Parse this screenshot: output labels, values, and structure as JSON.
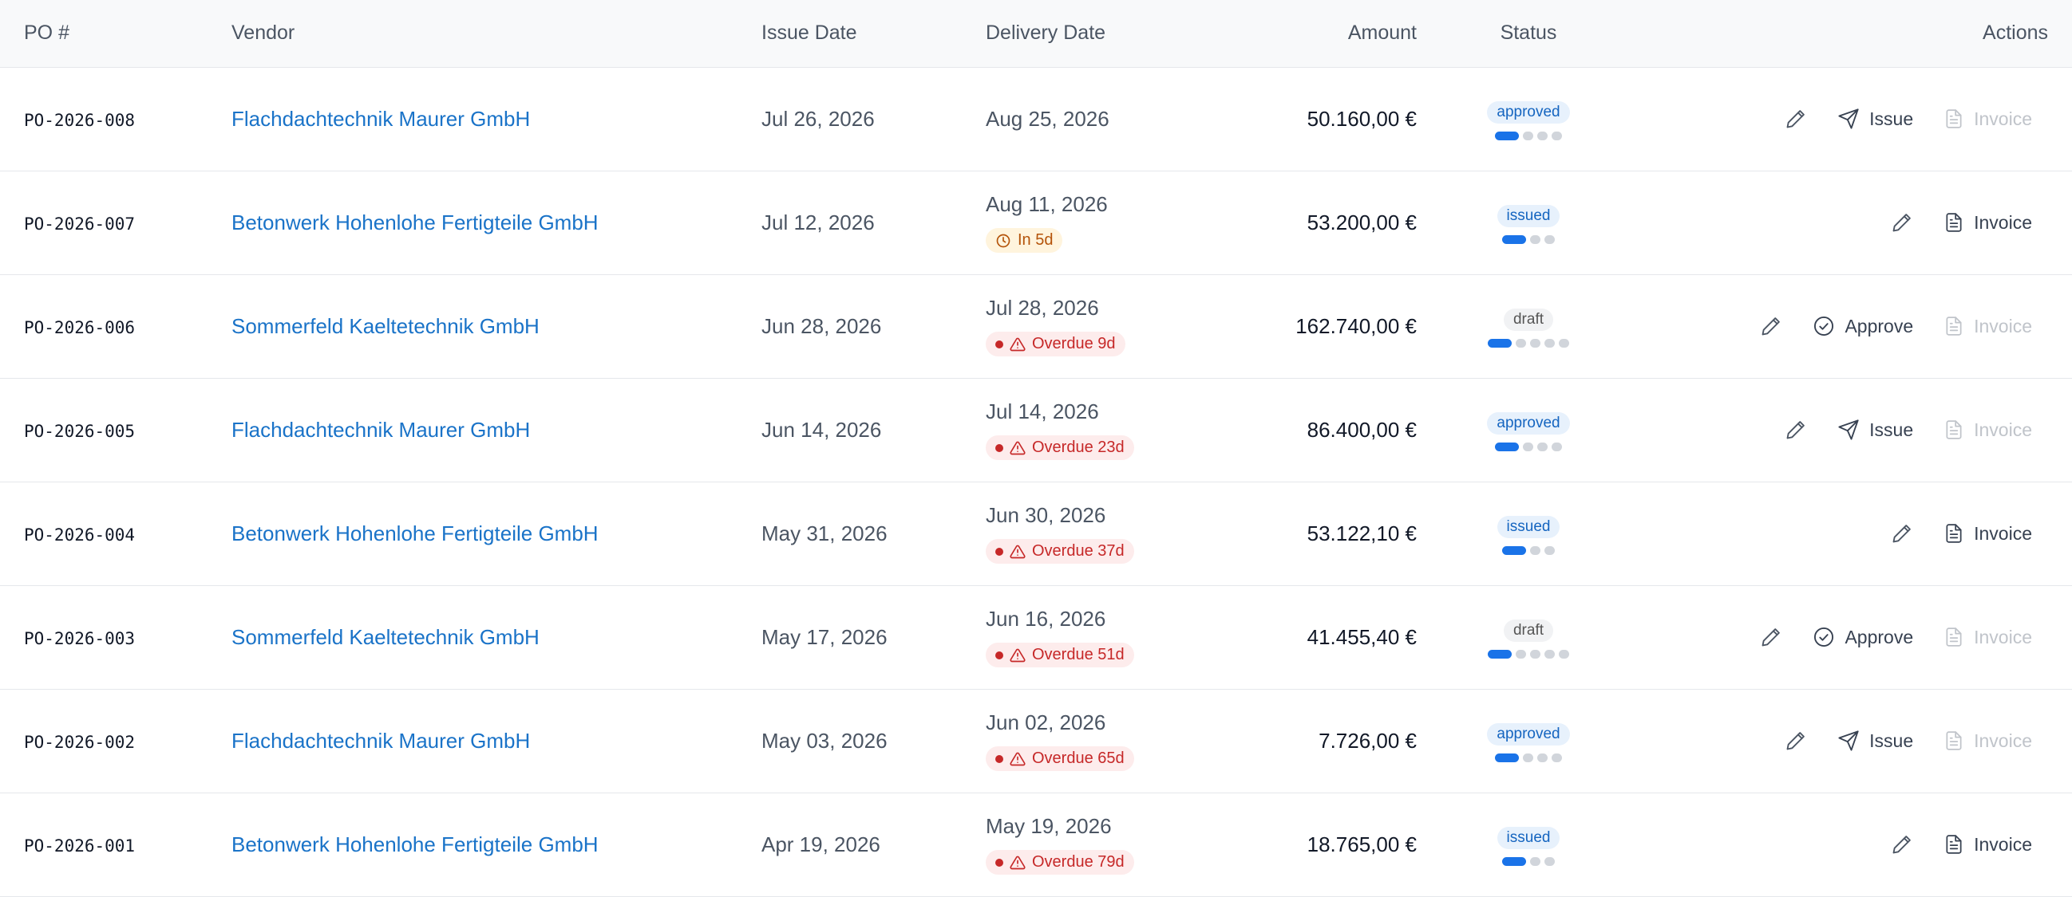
{
  "headers": {
    "po": "PO #",
    "vendor": "Vendor",
    "issue_date": "Issue Date",
    "delivery_date": "Delivery Date",
    "amount": "Amount",
    "status": "Status",
    "actions": "Actions"
  },
  "labels": {
    "issue": "Issue",
    "approve": "Approve",
    "invoice": "Invoice"
  },
  "colors": {
    "link": "#1a73c8",
    "progress_on": "#1a73e8",
    "overdue": "#c62828",
    "soon": "#b45309"
  },
  "rows": [
    {
      "po": "PO-2026-008",
      "vendor": "Flachdachtechnik Maurer GmbH",
      "issue_date": "Jul 26, 2026",
      "delivery_date": "Aug 25, 2026",
      "badge": null,
      "amount": "50.160,00 €",
      "status": "approved",
      "progress_done": 1,
      "progress_total": 4,
      "action": "Issue",
      "invoice_enabled": false
    },
    {
      "po": "PO-2026-007",
      "vendor": "Betonwerk Hohenlohe Fertigteile GmbH",
      "issue_date": "Jul 12, 2026",
      "delivery_date": "Aug 11, 2026",
      "badge": {
        "type": "soon",
        "text": "In 5d"
      },
      "amount": "53.200,00 €",
      "status": "issued",
      "progress_done": 1,
      "progress_total": 3,
      "action": null,
      "invoice_enabled": true
    },
    {
      "po": "PO-2026-006",
      "vendor": "Sommerfeld Kaeltetechnik GmbH",
      "issue_date": "Jun 28, 2026",
      "delivery_date": "Jul 28, 2026",
      "badge": {
        "type": "over",
        "text": "Overdue 9d"
      },
      "amount": "162.740,00 €",
      "status": "draft",
      "progress_done": 1,
      "progress_total": 5,
      "action": "Approve",
      "invoice_enabled": false
    },
    {
      "po": "PO-2026-005",
      "vendor": "Flachdachtechnik Maurer GmbH",
      "issue_date": "Jun 14, 2026",
      "delivery_date": "Jul 14, 2026",
      "badge": {
        "type": "over",
        "text": "Overdue 23d"
      },
      "amount": "86.400,00 €",
      "status": "approved",
      "progress_done": 1,
      "progress_total": 4,
      "action": "Issue",
      "invoice_enabled": false
    },
    {
      "po": "PO-2026-004",
      "vendor": "Betonwerk Hohenlohe Fertigteile GmbH",
      "issue_date": "May 31, 2026",
      "delivery_date": "Jun 30, 2026",
      "badge": {
        "type": "over",
        "text": "Overdue 37d"
      },
      "amount": "53.122,10 €",
      "status": "issued",
      "progress_done": 1,
      "progress_total": 3,
      "action": null,
      "invoice_enabled": true
    },
    {
      "po": "PO-2026-003",
      "vendor": "Sommerfeld Kaeltetechnik GmbH",
      "issue_date": "May 17, 2026",
      "delivery_date": "Jun 16, 2026",
      "badge": {
        "type": "over",
        "text": "Overdue 51d"
      },
      "amount": "41.455,40 €",
      "status": "draft",
      "progress_done": 1,
      "progress_total": 5,
      "action": "Approve",
      "invoice_enabled": false
    },
    {
      "po": "PO-2026-002",
      "vendor": "Flachdachtechnik Maurer GmbH",
      "issue_date": "May 03, 2026",
      "delivery_date": "Jun 02, 2026",
      "badge": {
        "type": "over",
        "text": "Overdue 65d"
      },
      "amount": "7.726,00 €",
      "status": "approved",
      "progress_done": 1,
      "progress_total": 4,
      "action": "Issue",
      "invoice_enabled": false
    },
    {
      "po": "PO-2026-001",
      "vendor": "Betonwerk Hohenlohe Fertigteile GmbH",
      "issue_date": "Apr 19, 2026",
      "delivery_date": "May 19, 2026",
      "badge": {
        "type": "over",
        "text": "Overdue 79d"
      },
      "amount": "18.765,00 €",
      "status": "issued",
      "progress_done": 1,
      "progress_total": 3,
      "action": null,
      "invoice_enabled": true
    }
  ]
}
